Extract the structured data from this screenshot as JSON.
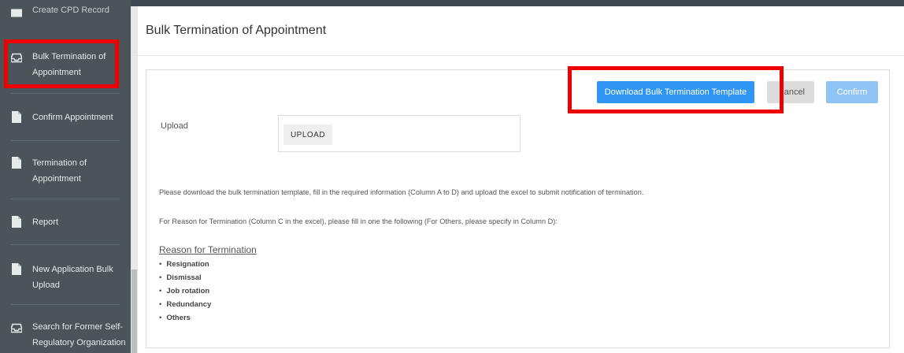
{
  "sidebar": {
    "items": [
      {
        "label": "Create CPD Record",
        "icon": "folder-icon"
      },
      {
        "label": "Bulk Termination of Appointment",
        "icon": "inbox-icon"
      },
      {
        "label": "Confirm Appointment",
        "icon": "file-icon"
      },
      {
        "label": "Termination of Appointment",
        "icon": "file-icon"
      },
      {
        "label": "Report",
        "icon": "file-icon"
      },
      {
        "label": "New Application Bulk Upload",
        "icon": "file-icon"
      },
      {
        "label": "Search for Former Self-Regulatory Organization",
        "icon": "inbox-icon"
      }
    ]
  },
  "page": {
    "title": "Bulk Termination of Appointment"
  },
  "actions": {
    "download_label": "Download Bulk Termination Template",
    "cancel_label": "ancel",
    "confirm_label": "Confirm"
  },
  "upload": {
    "label": "Upload",
    "button_label": "UPLOAD"
  },
  "instructions": {
    "paragraph1": "Please download the bulk termination template, fill in the required information (Column A to D) and upload the excel to submit notification of termination.",
    "paragraph2": "For Reason for Termination (Column C in the excel), please fill in one the following (For Others, please specify in Column D):",
    "reason_title": "Reason for Termination",
    "reasons": [
      "Resignation",
      "Dismissal",
      "Job rotation",
      "Redundancy",
      "Others"
    ]
  },
  "colors": {
    "sidebar_bg": "#4a5459",
    "primary_button": "#2f95f3",
    "disabled_button": "#8fc4f5",
    "highlight": "#ef0000"
  }
}
